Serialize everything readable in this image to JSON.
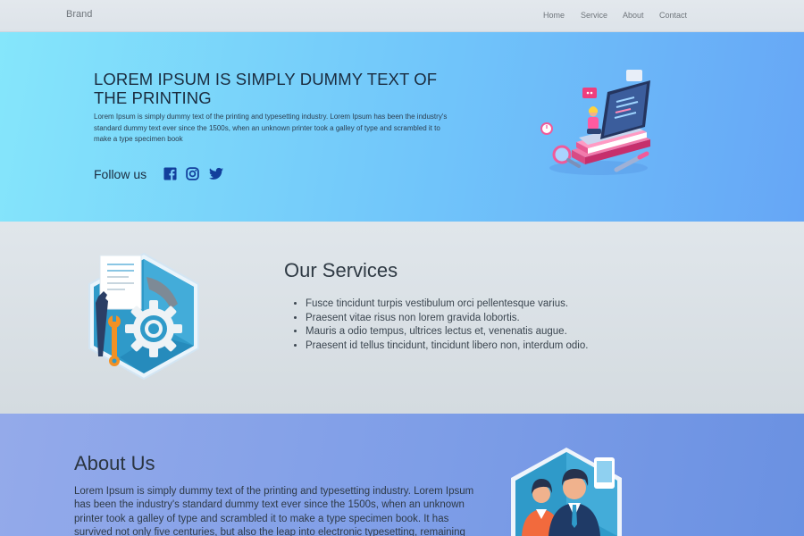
{
  "navbar": {
    "brand": "Brand",
    "links": [
      "Home",
      "Service",
      "About",
      "Contact"
    ]
  },
  "hero": {
    "title": "LOREM IPSUM IS SIMPLY DUMMY TEXT OF THE PRINTING",
    "text": "Lorem Ipsum is simply dummy text of the printing and typesetting industry. Lorem Ipsum has been the industry's standard dummy text ever since the 1500s, when an unknown printer took a galley of type and scrambled it to make a type specimen book",
    "follow_label": "Follow us",
    "social_icons": [
      "facebook-icon",
      "instagram-icon",
      "twitter-icon"
    ],
    "social_color": "#123f9c"
  },
  "services": {
    "title": "Our Services",
    "items": [
      "Fusce tincidunt turpis vestibulum orci pellentesque varius.",
      "Praesent vitae risus non lorem gravida lobortis.",
      "Mauris a odio tempus, ultrices lectus et, venenatis augue.",
      "Praesent id tellus tincidunt, tincidunt libero non, interdum odio."
    ]
  },
  "about": {
    "title": "About Us",
    "text": "Lorem Ipsum is simply dummy text of the printing and typesetting industry. Lorem Ipsum has been the industry's standard dummy text ever since the 1500s, when an unknown printer took a galley of type and scrambled it to make a type specimen book. It has survived not only five centuries, but also the leap into electronic typesetting, remaining essentially"
  },
  "colors": {
    "hero_gradient_start": "#85e6fb",
    "hero_gradient_end": "#66a6f6",
    "about_gradient_start": "#94aaea",
    "about_gradient_end": "#6a91e2"
  }
}
